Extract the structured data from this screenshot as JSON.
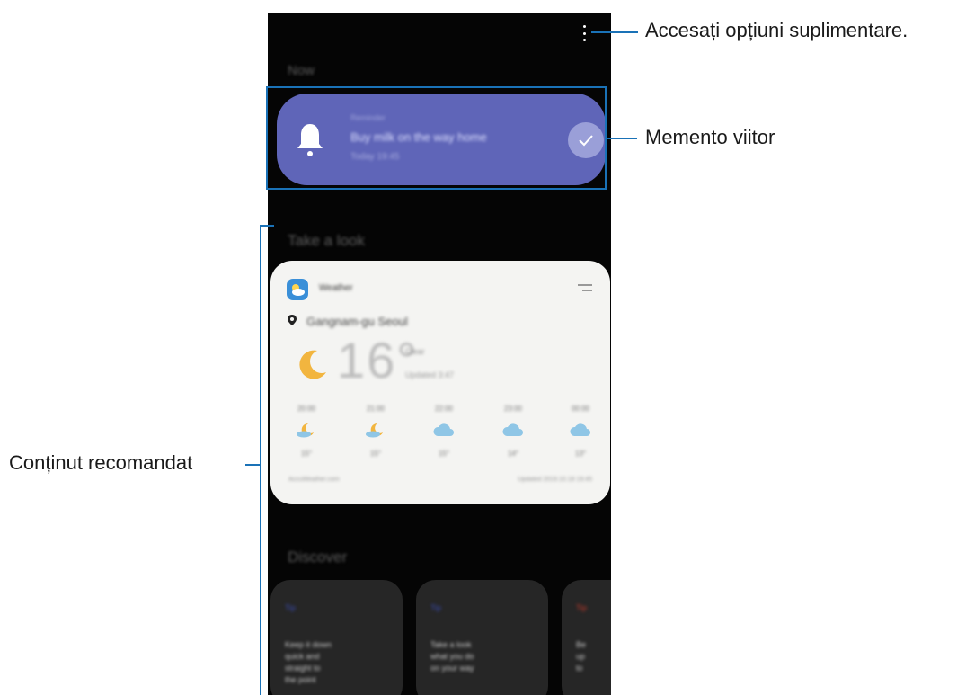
{
  "annotations": {
    "more_options": "Accesați opțiuni suplimentare.",
    "upcoming_reminder": "Memento viitor",
    "recommended_content": "Conținut recomandat"
  },
  "screen": {
    "now_header": "Now",
    "reminder": {
      "category": "Reminder",
      "title": "Buy milk on the way home",
      "time": "Today 19:45"
    },
    "take_a_look_header": "Take a look",
    "weather": {
      "app_name": "Weather",
      "location": "Gangnam-gu Seoul",
      "temperature": "16°",
      "condition": "Clear",
      "updated": "Updated 3:47",
      "forecast": [
        {
          "time": "20:00",
          "icon": "moon-cloud-icon",
          "temp": "15°"
        },
        {
          "time": "21:00",
          "icon": "moon-cloud-icon",
          "temp": "15°"
        },
        {
          "time": "22:00",
          "icon": "cloud-icon",
          "temp": "15°"
        },
        {
          "time": "23:00",
          "icon": "cloud-icon",
          "temp": "14°"
        },
        {
          "time": "00:00",
          "icon": "cloud-icon",
          "temp": "13°"
        }
      ],
      "footer_left": "AccuWeather.com",
      "footer_right": "Updated 2019.10.18 19:45"
    },
    "discover_header": "Discover",
    "discover_cards": [
      {
        "tag": "Tip",
        "tag_color": "#3a4bb0",
        "text": "Keep it down\nquick and\nstraight to\nthe point"
      },
      {
        "tag": "Tip",
        "tag_color": "#3a4bb0",
        "text": "Take a look\nwhat you do\non your way"
      },
      {
        "tag": "Tip",
        "tag_color": "#c0392b",
        "text": "Be\nup\nto"
      }
    ]
  },
  "colors": {
    "callout_line": "#1a72b7",
    "reminder_card": "#5f65b8",
    "screen_bg": "#050505"
  }
}
